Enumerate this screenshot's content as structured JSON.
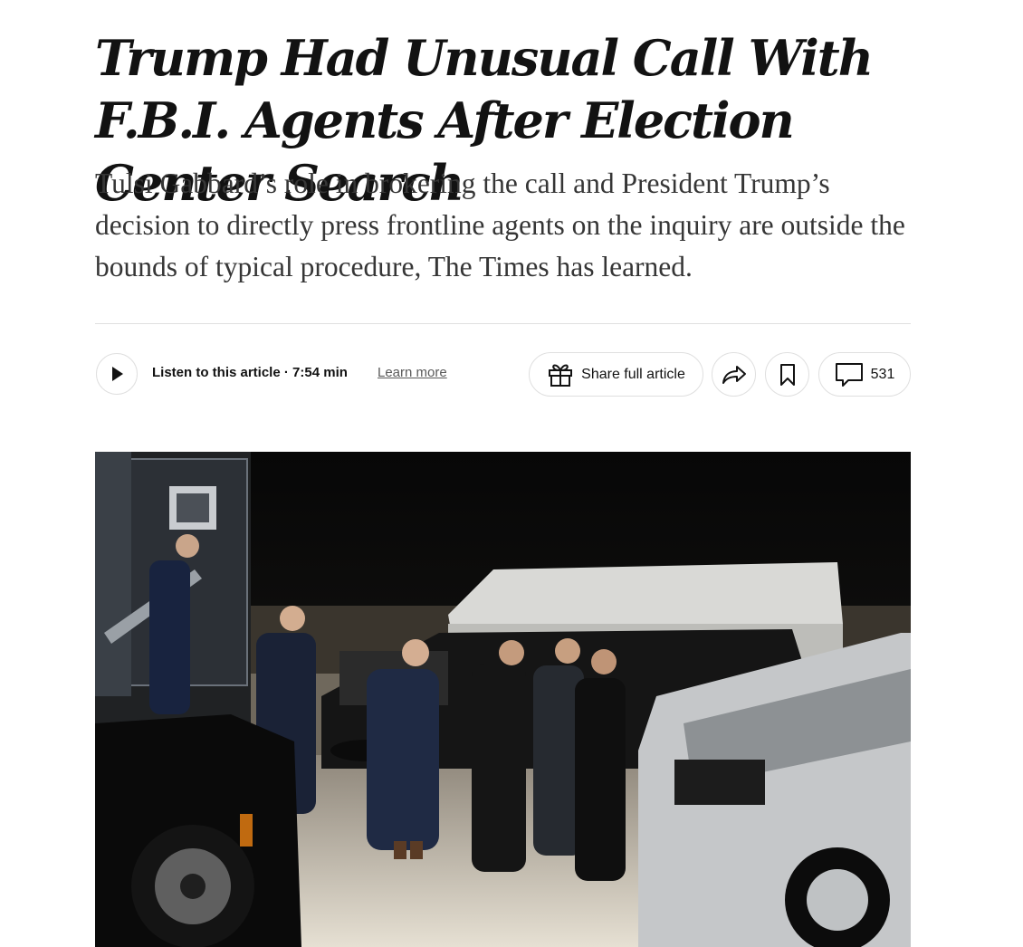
{
  "article": {
    "headline": "Trump Had Unusual Call With F.B.I. Agents After Election Center Search",
    "summary": "Tulsi Gabbard’s role in brokering the call and President Trump’s decision to directly press frontline agents on the inquiry are outside the bounds of typical procedure, The Times has learned."
  },
  "toolbar": {
    "listen_label": "Listen to this article",
    "separator": "·",
    "duration": "7:54 min",
    "learn_more": "Learn more",
    "share_full_label": "Share full article",
    "comment_count": "531"
  },
  "icons": {
    "play": "play-icon",
    "gift": "gift-icon",
    "share": "share-arrow-icon",
    "bookmark": "bookmark-icon",
    "comment": "comment-bubble-icon"
  },
  "photo": {
    "description_colors": {
      "sky": "#0b0b0b",
      "ground": "#d6d0c4",
      "van": "#d9d9d6"
    }
  }
}
